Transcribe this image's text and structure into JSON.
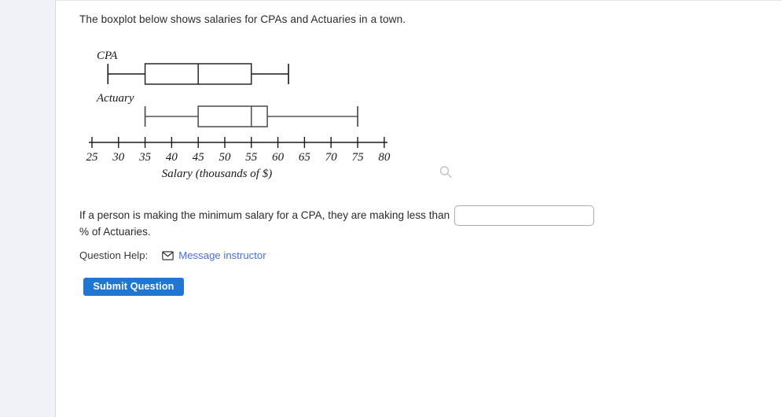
{
  "prompt": "The boxplot below shows salaries for CPAs and Actuaries in a town.",
  "chart_data": {
    "type": "box",
    "title": "",
    "xlabel": "Salary (thousands of $)",
    "ylabel": "",
    "xlim": [
      25,
      80
    ],
    "xticks": [
      25,
      30,
      35,
      40,
      45,
      50,
      55,
      60,
      65,
      70,
      75,
      80
    ],
    "xtick_labels": [
      "25",
      "30",
      "35",
      "40",
      "45",
      "50",
      "55",
      "60",
      "65",
      "70",
      "75",
      "80"
    ],
    "grid": false,
    "legend": "none",
    "orientation": "horizontal",
    "series": [
      {
        "name": "CPA",
        "min": 28,
        "q1": 35,
        "median": 45,
        "q3": 55,
        "max": 62
      },
      {
        "name": "Actuary",
        "min": 35,
        "q1": 45,
        "median": 55,
        "q3": 58,
        "max": 75
      }
    ]
  },
  "question": {
    "text_before_input": "If a person is making the minimum salary for a CPA, they are making less than",
    "input_value": "",
    "input_placeholder": "",
    "text_after_input": "% of Actuaries."
  },
  "help": {
    "label": "Question Help:",
    "message_instructor": "Message instructor",
    "envelope_icon": "envelope-icon"
  },
  "submit": {
    "label": "Submit Question"
  },
  "icons": {
    "magnifier": "search-icon"
  },
  "colors": {
    "accent_blue": "#2176d2",
    "link_blue": "#4a6fd4",
    "sidebar_bg": "#f1f1f8",
    "plot_stroke": "#1a1a1a",
    "text": "#2b2b2b"
  }
}
